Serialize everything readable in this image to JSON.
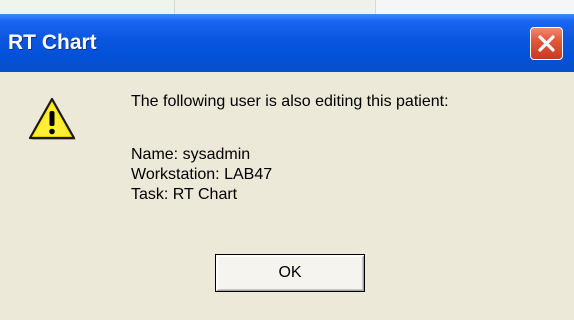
{
  "window": {
    "title": "RT Chart",
    "close_icon": "close-icon"
  },
  "dialog": {
    "icon": "warning-icon",
    "message": "The following user is also editing this patient:",
    "details": {
      "name": "Name: sysadmin",
      "workstation": "Workstation: LAB47",
      "task": "Task: RT Chart"
    },
    "ok_label": "OK"
  },
  "colors": {
    "titlebar": "#0a56e0",
    "close_button": "#e4573a",
    "dialog_bg": "#ece9d8",
    "warning_yellow": "#ffe600"
  }
}
